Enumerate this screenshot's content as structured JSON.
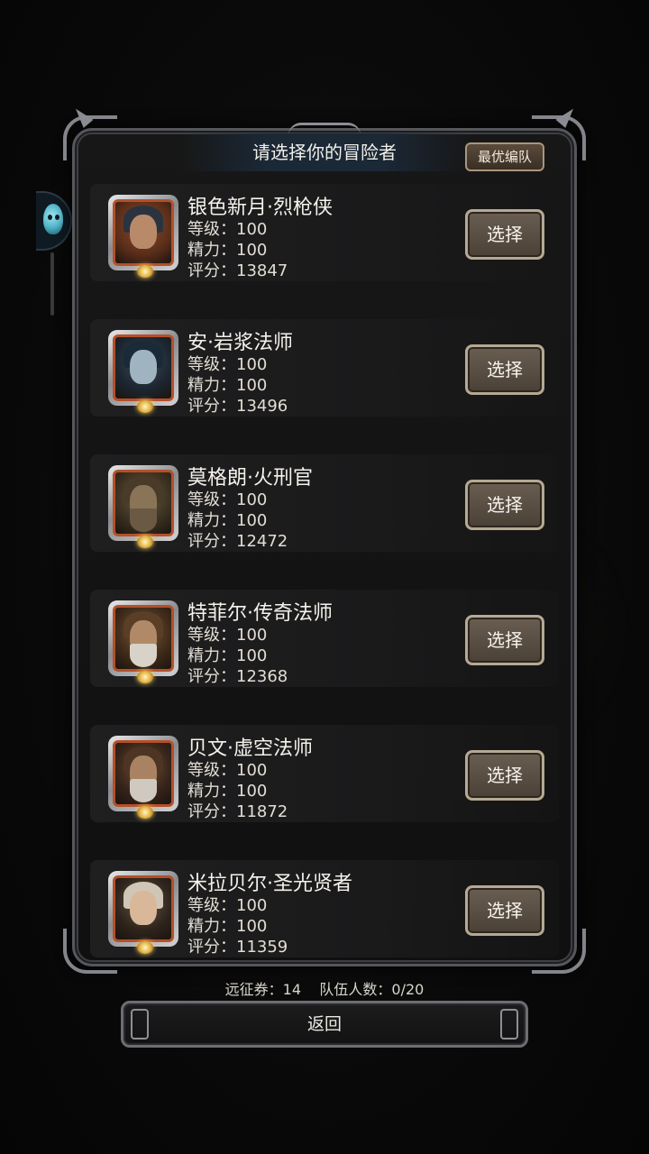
{
  "dialog": {
    "title": "请选择你的冒险者",
    "best_team_label": "最优编队"
  },
  "heroes": [
    {
      "name": "银色新月·烈枪侠",
      "level": "等级：100",
      "energy": "精力：100",
      "score": "评分：13847",
      "select_label": "选择"
    },
    {
      "name": "安·岩浆法师",
      "level": "等级：100",
      "energy": "精力：100",
      "score": "评分：13496",
      "select_label": "选择"
    },
    {
      "name": "莫格朗·火刑官",
      "level": "等级：100",
      "energy": "精力：100",
      "score": "评分：12472",
      "select_label": "选择"
    },
    {
      "name": "特菲尔·传奇法师",
      "level": "等级：100",
      "energy": "精力：100",
      "score": "评分：12368",
      "select_label": "选择"
    },
    {
      "name": "贝文·虚空法师",
      "level": "等级：100",
      "energy": "精力：100",
      "score": "评分：11872",
      "select_label": "选择"
    },
    {
      "name": "米拉贝尔·圣光贤者",
      "level": "等级：100",
      "energy": "精力：100",
      "score": "评分：11359",
      "select_label": "选择"
    }
  ],
  "footer": {
    "expedition_tickets": "远征券：14",
    "team_count": "队伍人数：0/20",
    "back_label": "返回"
  },
  "colors": {
    "portrait_border": "#b4502a",
    "button_fill": "#5a4e43",
    "button_border": "#b5a992"
  }
}
